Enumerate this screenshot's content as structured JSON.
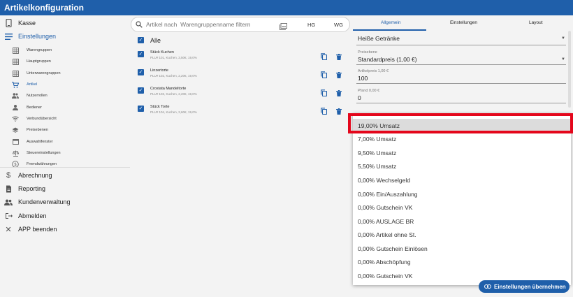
{
  "window": {
    "title": "Artikelkonfiguration"
  },
  "sidebar": {
    "kasse": "Kasse",
    "einstellungen": "Einstellungen",
    "sub_items": [
      {
        "label": "Warengruppen",
        "icon": "grid-icon"
      },
      {
        "label": "Hauptgruppen",
        "icon": "grid-icon"
      },
      {
        "label": "Unterwarengruppen",
        "icon": "grid-icon"
      },
      {
        "label": "Artikel",
        "icon": "cart-icon"
      },
      {
        "label": "Nutzerrollen",
        "icon": "people-icon"
      },
      {
        "label": "Bediener",
        "icon": "person-icon"
      },
      {
        "label": "Verbundübersicht",
        "icon": "wifi-icon"
      },
      {
        "label": "Preisebenen",
        "icon": "layers-icon"
      },
      {
        "label": "Auswahlfenster",
        "icon": "window-icon"
      },
      {
        "label": "Steuereinstellungen",
        "icon": "scale-icon"
      },
      {
        "label": "Fremdwährungen",
        "icon": "currency-icon"
      }
    ],
    "abrechnung": "Abrechnung",
    "reporting": "Reporting",
    "kundenverwaltung": "Kundenverwaltung",
    "abmelden": "Abmelden",
    "app_beenden": "APP beenden"
  },
  "search": {
    "placeholder": "Artikel nach  Warengruppenname filtern",
    "hg": "HG",
    "wg": "WG"
  },
  "list": {
    "all_label": "Alle",
    "articles": [
      {
        "name": "Stück Kuchen",
        "sub": "PLU# 101, Kuchen, 3,50€, 19,0%"
      },
      {
        "name": "Linzertorte",
        "sub": "PLU# 102, Kuchen, 2,20€, 19,0%"
      },
      {
        "name": "Crostata Mandeltorte",
        "sub": "PLU# 103, Kuchen, 2,20€, 19,0%"
      },
      {
        "name": "Stück Torte",
        "sub": "PLU# 104, Kuchen, 2,60€, 19,0%"
      }
    ]
  },
  "tabs": {
    "allgemein": "Allgemein",
    "einstellungen": "Einstellungen",
    "layout": "Layout"
  },
  "form": {
    "group_value": "Heiße Getränke",
    "preisebene_label": "Preisebene",
    "preisebene_value": "Standardpreis (1,00 €)",
    "artikelpreis_label": "Artikelpreis 1,00 €",
    "artikelpreis_value": "100",
    "pfand_label": "Pfand 0,00 €",
    "pfand_value": "0"
  },
  "dropdown": {
    "options": [
      "19,00% Umsatz",
      "7,00% Umsatz",
      "9,50% Umsatz",
      "5,50% Umsatz",
      "0,00% Wechselgeld",
      "0,00% Ein/Auszahlung",
      "0,00% Gutschein VK",
      "0,00% AUSLAGE BR",
      "0,00% Artikel ohne St.",
      "0,00% Gutschein Einlösen",
      "0,00% Abschöpfung",
      "0,00% Gutschein VK"
    ],
    "selected_index": 0
  },
  "apply_button": {
    "label": "Einstellungen übernehmen"
  },
  "colors": {
    "primary": "#1f5faa",
    "highlight": "#e4061b"
  }
}
